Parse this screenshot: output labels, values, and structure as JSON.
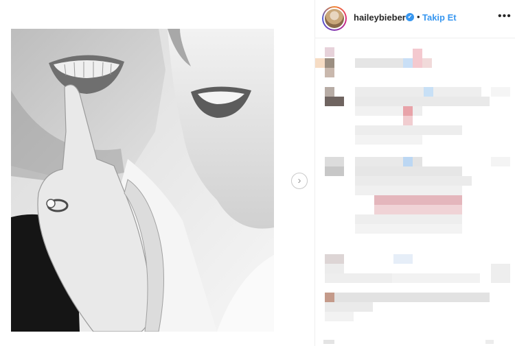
{
  "post": {
    "next_icon": "chevron-right-icon"
  },
  "header": {
    "username": "haileybieber",
    "verified_icon": "✔",
    "separator": "•",
    "follow_label": "Takip Et",
    "more_icon": "•••"
  },
  "colors": {
    "accent": "#3897f0",
    "text": "#262626",
    "border": "#efefef"
  }
}
